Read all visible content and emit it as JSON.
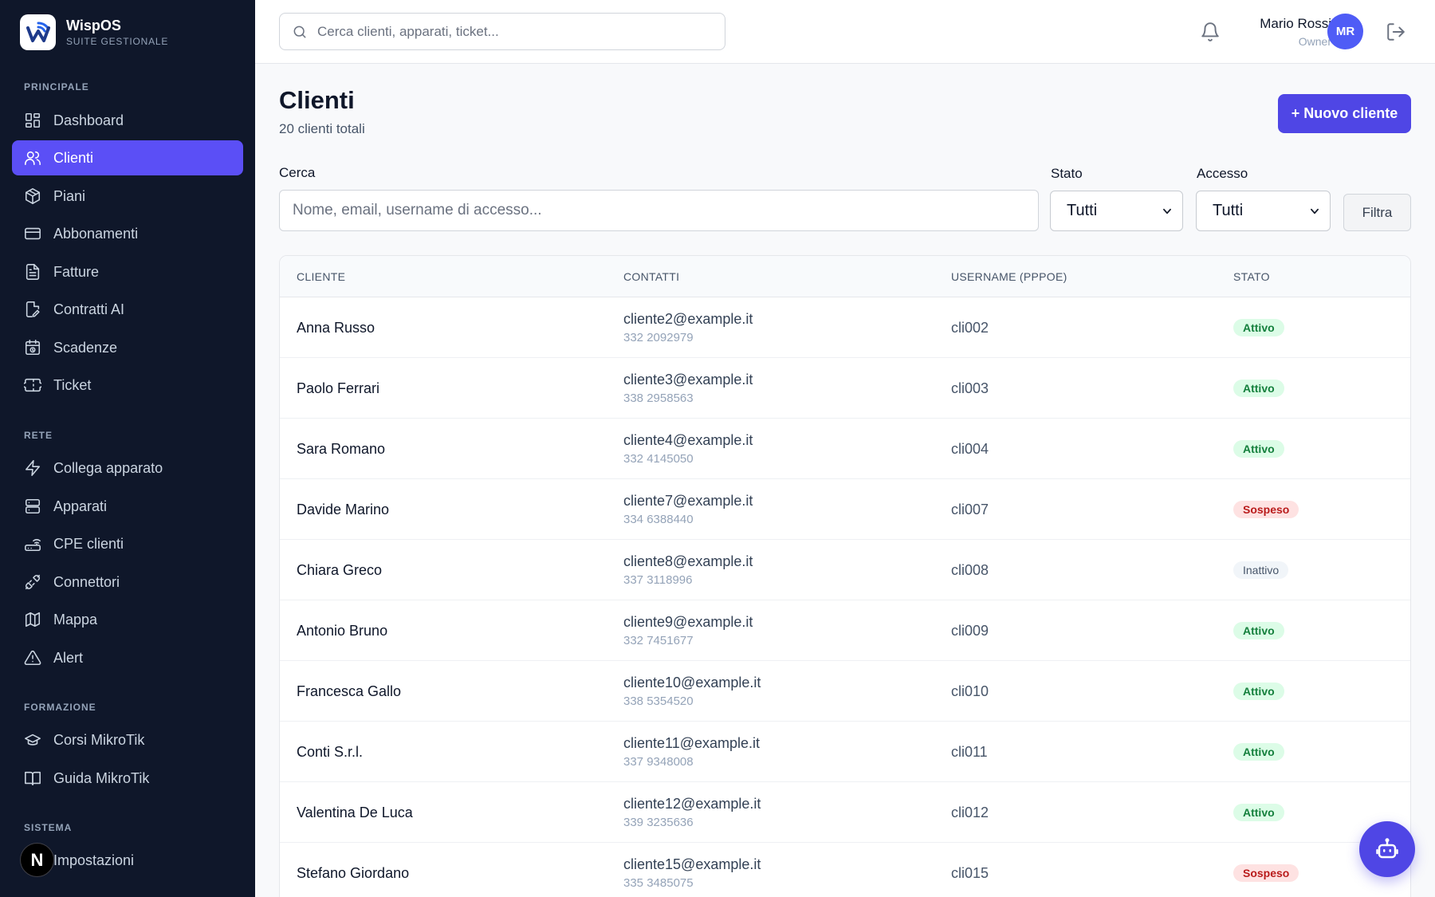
{
  "brand": {
    "name": "WispOS",
    "subtitle": "SUITE GESTIONALE"
  },
  "sidebar": {
    "sections": [
      {
        "label": "PRINCIPALE"
      },
      {
        "label": "RETE"
      },
      {
        "label": "FORMAZIONE"
      },
      {
        "label": "SISTEMA"
      }
    ],
    "items": [
      {
        "label": "Dashboard",
        "icon": "dashboard-icon"
      },
      {
        "label": "Clienti",
        "icon": "users-icon",
        "active": true
      },
      {
        "label": "Piani",
        "icon": "package-icon"
      },
      {
        "label": "Abbonamenti",
        "icon": "credit-card-icon"
      },
      {
        "label": "Fatture",
        "icon": "invoice-icon"
      },
      {
        "label": "Contratti AI",
        "icon": "contract-icon"
      },
      {
        "label": "Scadenze",
        "icon": "calendar-clock-icon"
      },
      {
        "label": "Ticket",
        "icon": "ticket-icon"
      },
      {
        "label": "Collega apparato",
        "icon": "bolt-icon"
      },
      {
        "label": "Apparati",
        "icon": "server-icon"
      },
      {
        "label": "CPE clienti",
        "icon": "router-icon"
      },
      {
        "label": "Connettori",
        "icon": "plug-icon"
      },
      {
        "label": "Mappa",
        "icon": "map-icon"
      },
      {
        "label": "Alert",
        "icon": "alert-triangle-icon"
      },
      {
        "label": "Corsi MikroTik",
        "icon": "graduation-cap-icon"
      },
      {
        "label": "Guida MikroTik",
        "icon": "book-icon"
      },
      {
        "label": "Impostazioni",
        "icon": "settings-icon"
      }
    ],
    "next_badge": "N"
  },
  "topbar": {
    "search_placeholder": "Cerca clienti, apparati, ticket...",
    "user_name": "Mario Rossi",
    "user_role": "Owner",
    "avatar_initials": "MR"
  },
  "page": {
    "title": "Clienti",
    "subtitle": "20 clienti totali",
    "new_button": "+ Nuovo cliente"
  },
  "filters": {
    "search_label": "Cerca",
    "search_placeholder": "Nome, email, username di accesso...",
    "stato_label": "Stato",
    "stato_value": "Tutti",
    "accesso_label": "Accesso",
    "accesso_value": "Tutti",
    "filter_button": "Filtra"
  },
  "table": {
    "headers": [
      "CLIENTE",
      "CONTATTI",
      "USERNAME (PPPOE)",
      "STATO"
    ],
    "rows": [
      {
        "name": "Anna Russo",
        "email": "cliente2@example.it",
        "phone": "332 2092979",
        "username": "cli002",
        "status": "Attivo",
        "status_kind": "green"
      },
      {
        "name": "Paolo Ferrari",
        "email": "cliente3@example.it",
        "phone": "338 2958563",
        "username": "cli003",
        "status": "Attivo",
        "status_kind": "green"
      },
      {
        "name": "Sara Romano",
        "email": "cliente4@example.it",
        "phone": "332 4145050",
        "username": "cli004",
        "status": "Attivo",
        "status_kind": "green"
      },
      {
        "name": "Davide Marino",
        "email": "cliente7@example.it",
        "phone": "334 6388440",
        "username": "cli007",
        "status": "Sospeso",
        "status_kind": "red"
      },
      {
        "name": "Chiara Greco",
        "email": "cliente8@example.it",
        "phone": "337 3118996",
        "username": "cli008",
        "status": "Inattivo",
        "status_kind": "gray"
      },
      {
        "name": "Antonio Bruno",
        "email": "cliente9@example.it",
        "phone": "332 7451677",
        "username": "cli009",
        "status": "Attivo",
        "status_kind": "green"
      },
      {
        "name": "Francesca Gallo",
        "email": "cliente10@example.it",
        "phone": "338 5354520",
        "username": "cli010",
        "status": "Attivo",
        "status_kind": "green"
      },
      {
        "name": "Conti S.r.l.",
        "email": "cliente11@example.it",
        "phone": "337 9348008",
        "username": "cli011",
        "status": "Attivo",
        "status_kind": "green"
      },
      {
        "name": "Valentina De Luca",
        "email": "cliente12@example.it",
        "phone": "339 3235636",
        "username": "cli012",
        "status": "Attivo",
        "status_kind": "green"
      },
      {
        "name": "Stefano Giordano",
        "email": "cliente15@example.it",
        "phone": "335 3485075",
        "username": "cli015",
        "status": "Sospeso",
        "status_kind": "red"
      }
    ]
  },
  "colors": {
    "sidebar_bg": "#0f172a",
    "accent": "#5b4ff6",
    "primary_button": "#4f46e5",
    "status_active": "#15803d",
    "status_suspended": "#b91c1c"
  },
  "assistant_fab_icon": "robot-icon"
}
